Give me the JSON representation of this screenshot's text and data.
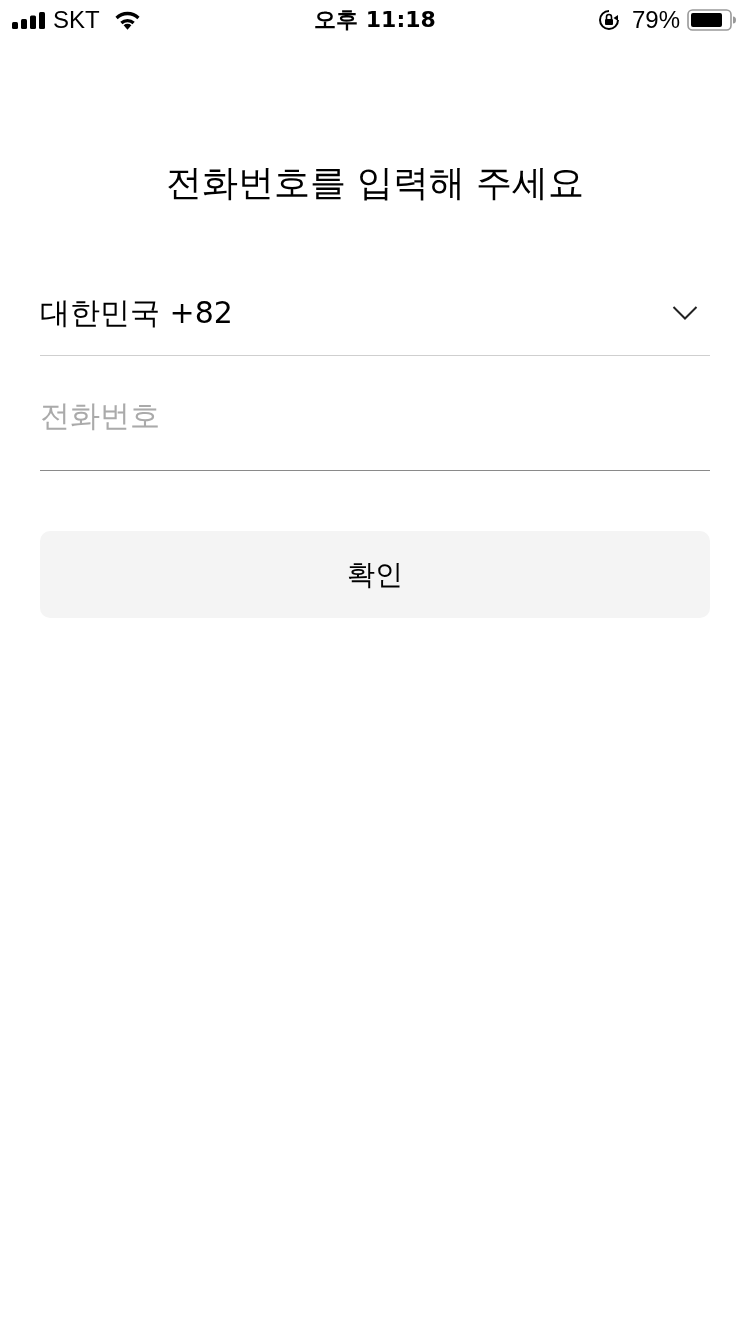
{
  "status_bar": {
    "carrier": "SKT",
    "time": "오후 11:18",
    "battery": "79%"
  },
  "title": "전화번호를 입력해 주세요",
  "country_select": {
    "value": "대한민국 +82"
  },
  "phone_field": {
    "placeholder": "전화번호"
  },
  "confirm_button": {
    "label": "확인"
  }
}
